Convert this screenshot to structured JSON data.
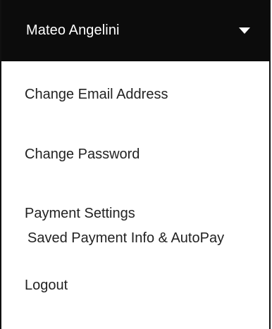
{
  "account_menu": {
    "user_name": "Mateo Angelini",
    "toggle_icon": "caret-down-icon",
    "colors": {
      "header_bg": "#0c0c0c",
      "header_text": "#ffffff",
      "item_text": "#222222"
    },
    "items": [
      {
        "label": "Change Email Address"
      },
      {
        "label": "Change Password"
      },
      {
        "label": "Payment Settings",
        "sublabel": "Saved Payment Info & AutoPay"
      },
      {
        "label": "Logout"
      }
    ]
  }
}
